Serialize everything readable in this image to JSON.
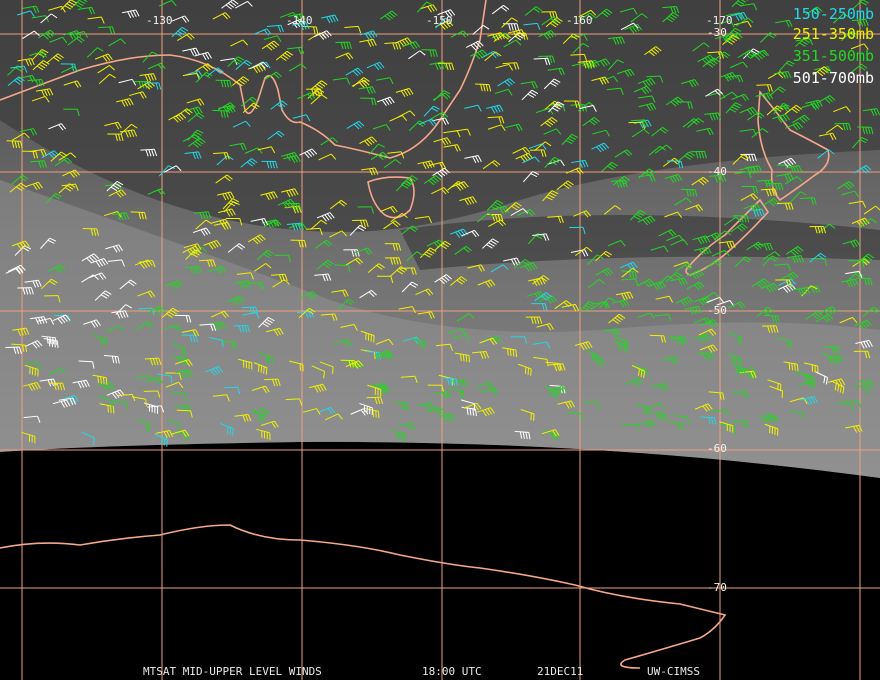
{
  "longitude_labels": [
    "-130",
    "-140",
    "-150",
    "-160",
    "-170"
  ],
  "latitude_labels": [
    "-30",
    "-40",
    "-50",
    "-60",
    "-70"
  ],
  "legend": [
    {
      "label": "150-250mb",
      "color": "#22d8e8"
    },
    {
      "label": "251-350mb",
      "color": "#f0f000"
    },
    {
      "label": "351-500mb",
      "color": "#22d822"
    },
    {
      "label": "501-700mb",
      "color": "#ffffff"
    }
  ],
  "footer": {
    "product": "MTSAT MID-UPPER LEVEL WINDS",
    "time": "18:00 UTC",
    "date": "21DEC11",
    "source": "UW-CIMSS"
  },
  "colors": {
    "grid": "#f0a080",
    "coast": "#f4a888",
    "space": "#000000",
    "image_light": "#8a8a8a",
    "image_dark": "#3c3c3c"
  }
}
